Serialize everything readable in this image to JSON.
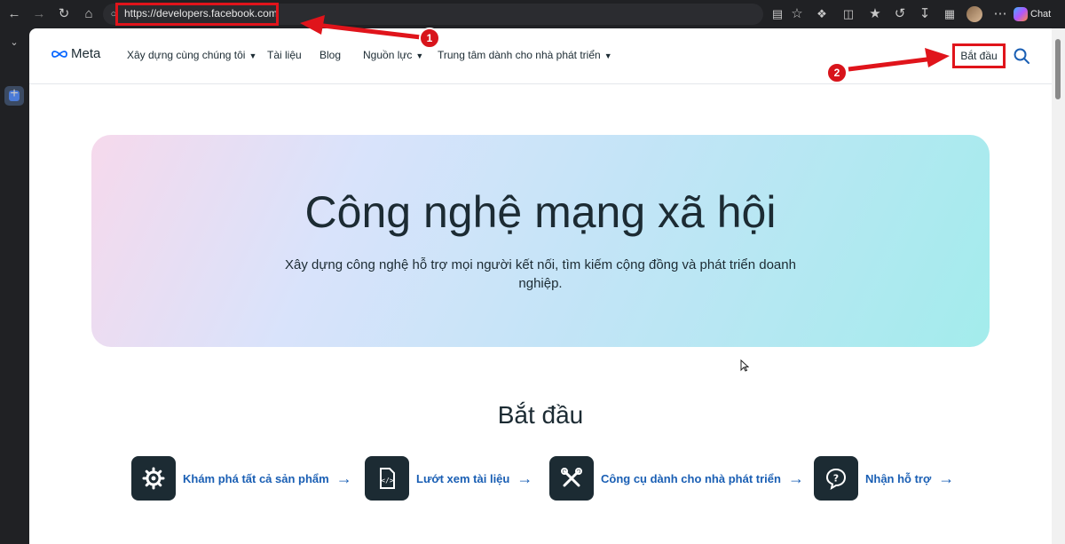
{
  "browser": {
    "url": "https://developers.facebook.com",
    "chat_label": "Chat"
  },
  "nav": {
    "logo": "Meta",
    "items": [
      {
        "label": "Xây dựng cùng chúng tôi",
        "has_dropdown": true
      },
      {
        "label": "Tài liệu",
        "has_dropdown": false
      },
      {
        "label": "Blog",
        "has_dropdown": false
      },
      {
        "label": "Nguồn lực",
        "has_dropdown": true
      },
      {
        "label": "Trung tâm dành cho nhà phát triển",
        "has_dropdown": true
      }
    ],
    "start_label": "Bắt đầu"
  },
  "hero": {
    "title": "Công nghệ mạng xã hội",
    "subtitle": "Xây dựng công nghệ hỗ trợ mọi người kết nối, tìm kiếm cộng đồng và phát triển doanh nghiệp."
  },
  "get_started": {
    "title": "Bắt đầu",
    "cards": [
      {
        "label": "Khám phá tất cả sản phẩm",
        "icon": "gear-icon"
      },
      {
        "label": "Lướt xem tài liệu",
        "icon": "code-file-icon"
      },
      {
        "label": "Công cụ dành cho nhà phát triển",
        "icon": "tools-icon"
      },
      {
        "label": "Nhận hỗ trợ",
        "icon": "help-icon"
      }
    ]
  },
  "annotations": {
    "badge1": "1",
    "badge2": "2"
  },
  "colors": {
    "annotation_red": "#e0141b",
    "link_blue": "#1a5fb4",
    "text_dark": "#1c2b33"
  }
}
